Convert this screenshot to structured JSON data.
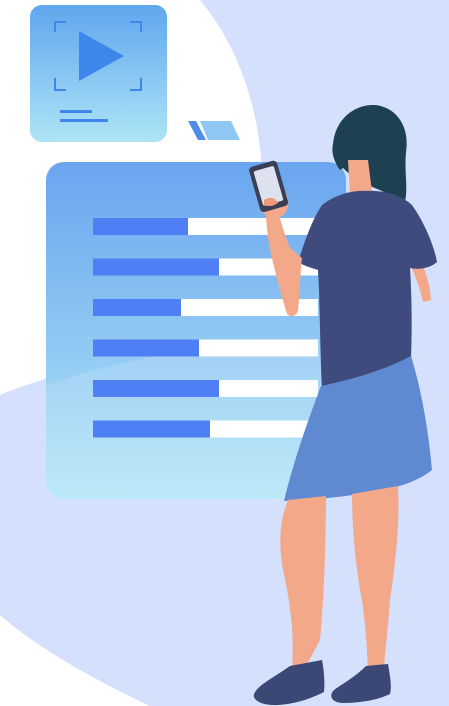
{
  "illustration": {
    "colors": {
      "background": "#ffffff",
      "backdrop": "#d5e0fc",
      "panel_top": "#6aa5ef",
      "panel_bottom": "#b2e6f7",
      "bar_blue": "#4f7ff5",
      "bar_white": "#ffffff",
      "media_card_top": "#5fa7ee",
      "media_card_bottom": "#aee4f6",
      "play_icon": "#3f86ea",
      "hair": "#1d4150",
      "skin": "#f4a88a",
      "shirt": "#3f4b7c",
      "skirt": "#5f8ad2",
      "shoes": "#3b4774",
      "phone": "#3a3f57"
    },
    "icons": [
      "play-icon",
      "frame-corner-icon",
      "tag-icon"
    ],
    "list_bars_fill": [
      0.42,
      0.56,
      0.39,
      0.47,
      0.56,
      0.52
    ]
  }
}
